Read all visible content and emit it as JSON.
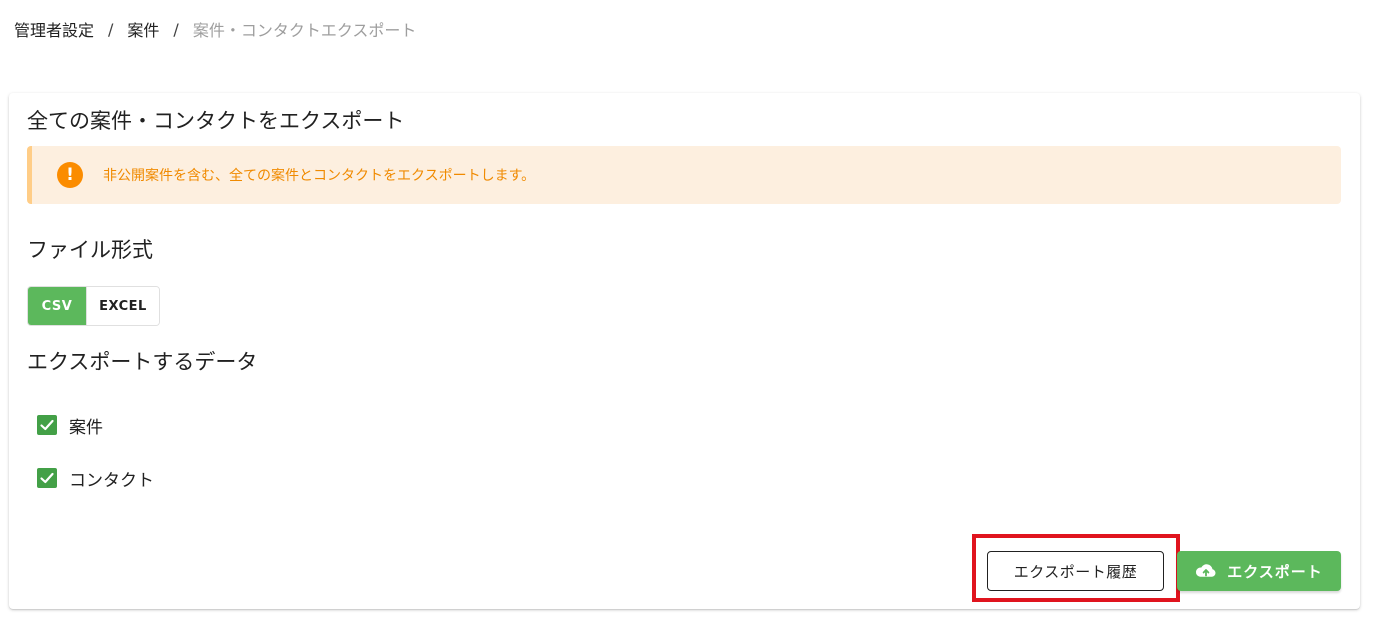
{
  "breadcrumb": {
    "items": [
      "管理者設定",
      "案件",
      "案件・コンタクトエクスポート"
    ],
    "separator": "/"
  },
  "card": {
    "title": "全ての案件・コンタクトをエクスポート",
    "alert": {
      "icon": "exclamation-circle-icon",
      "text": "非公開案件を含む、全ての案件とコンタクトをエクスポートします。"
    },
    "file_format": {
      "title": "ファイル形式",
      "options": [
        "CSV",
        "EXCEL"
      ],
      "selected": "CSV"
    },
    "export_data": {
      "title": "エクスポートするデータ",
      "items": [
        {
          "label": "案件",
          "checked": true
        },
        {
          "label": "コンタクト",
          "checked": true
        }
      ]
    },
    "actions": {
      "history_label": "エクスポート履歴",
      "export_label": "エクスポート",
      "export_icon": "cloud-upload-icon"
    }
  },
  "colors": {
    "accent_green": "#5cb85c",
    "warning_bg": "#fdefdf",
    "warning_text": "#f08a00",
    "highlight_red": "#e0141e"
  }
}
